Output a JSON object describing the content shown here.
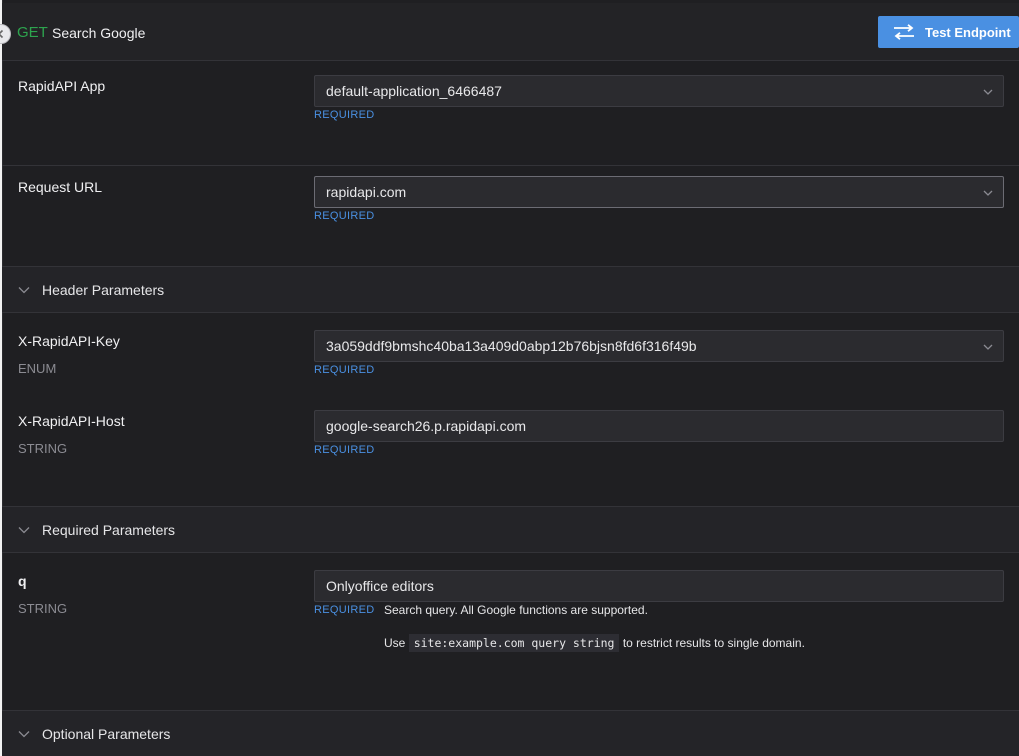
{
  "header": {
    "method": "GET",
    "endpoint_name": "Search Google",
    "test_button_label": "Test Endpoint"
  },
  "app_row": {
    "label": "RapidAPI App",
    "value": "default-application_6466487",
    "required": "REQUIRED"
  },
  "url_row": {
    "label": "Request URL",
    "value": "rapidapi.com",
    "required": "REQUIRED"
  },
  "header_params": {
    "title": "Header Parameters",
    "params": [
      {
        "name": "X-RapidAPI-Key",
        "type": "ENUM",
        "value": "3a059ddf9bmshc40ba13a409d0abp12b76bjsn8fd6f316f49b",
        "required": "REQUIRED"
      },
      {
        "name": "X-RapidAPI-Host",
        "type": "STRING",
        "value": "google-search26.p.rapidapi.com",
        "required": "REQUIRED"
      }
    ]
  },
  "required_params": {
    "title": "Required Parameters",
    "params": [
      {
        "name": "q",
        "type": "STRING",
        "value": "Onlyoffice editors",
        "required": "REQUIRED",
        "description": "Search query. All Google functions are supported.",
        "hint_prefix": "Use",
        "hint_code": "site:example.com query string",
        "hint_suffix": "to restrict results to single domain."
      }
    ]
  },
  "optional_params": {
    "title": "Optional Parameters"
  },
  "colors": {
    "method_get": "#2da44e",
    "accent": "#4a90e2",
    "background": "#1f1f22"
  }
}
